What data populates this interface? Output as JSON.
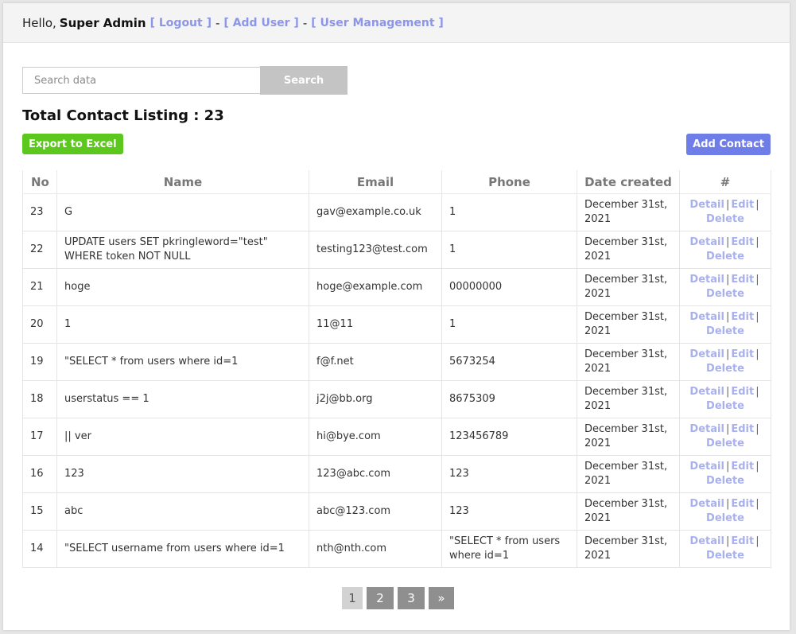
{
  "header": {
    "greeting": "Hello,",
    "user_name": "Super Admin",
    "logout": "[ Logout ]",
    "add_user": "[ Add User ]",
    "user_management": "[ User Management ]",
    "separator": "-"
  },
  "search": {
    "placeholder": "Search data",
    "value": "",
    "button_label": "Search"
  },
  "listing": {
    "title": "Total Contact Listing : 23"
  },
  "buttons": {
    "export": "Export to Excel",
    "add_contact": "Add Contact"
  },
  "colors": {
    "link": "#8c95e8",
    "action_link": "#a9b0ee",
    "export_green": "#5cc71c",
    "add_blue": "#6f7de8"
  },
  "table": {
    "headers": [
      "No",
      "Name",
      "Email",
      "Phone",
      "Date created",
      "#"
    ],
    "actions": {
      "detail": "Detail",
      "edit": "Edit",
      "delete": "Delete",
      "sep": "|"
    },
    "rows": [
      {
        "no": "23",
        "name": "G",
        "email": "gav@example.co.uk",
        "phone": "1",
        "date": "December 31st, 2021"
      },
      {
        "no": "22",
        "name": "UPDATE users SET pkringleword=\"test\" WHERE token NOT NULL",
        "email": "testing123@test.com",
        "phone": "1",
        "date": "December 31st, 2021"
      },
      {
        "no": "21",
        "name": "hoge",
        "email": "hoge@example.com",
        "phone": "00000000",
        "date": "December 31st, 2021"
      },
      {
        "no": "20",
        "name": "1",
        "email": "11@11",
        "phone": "1",
        "date": "December 31st, 2021"
      },
      {
        "no": "19",
        "name": "\"SELECT * from users where id=1",
        "email": "f@f.net",
        "phone": "5673254",
        "date": "December 31st, 2021"
      },
      {
        "no": "18",
        "name": "userstatus == 1",
        "email": "j2j@bb.org",
        "phone": "8675309",
        "date": "December 31st, 2021"
      },
      {
        "no": "17",
        "name": "|| ver",
        "email": "hi@bye.com",
        "phone": "123456789",
        "date": "December 31st, 2021"
      },
      {
        "no": "16",
        "name": "123",
        "email": "123@abc.com",
        "phone": "123",
        "date": "December 31st, 2021"
      },
      {
        "no": "15",
        "name": "abc",
        "email": "abc@123.com",
        "phone": "123",
        "date": "December 31st, 2021"
      },
      {
        "no": "14",
        "name": "\"SELECT username from users where id=1",
        "email": "nth@nth.com",
        "phone": "\"SELECT * from users where id=1",
        "date": "December 31st, 2021"
      }
    ]
  },
  "pagination": {
    "current": "1",
    "pages": [
      "2",
      "3"
    ],
    "next": "»"
  }
}
